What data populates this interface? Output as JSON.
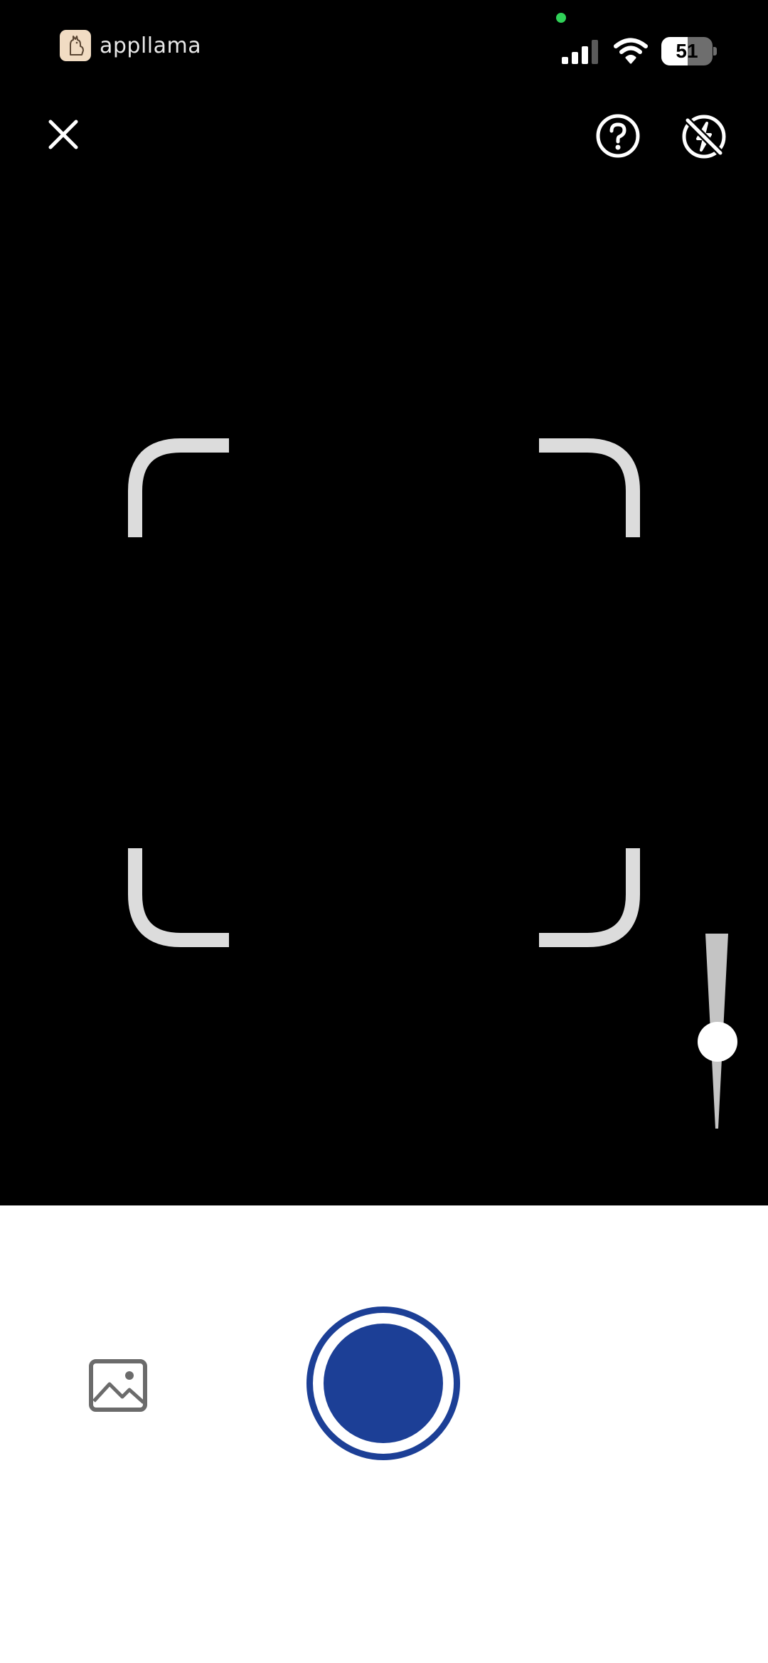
{
  "status_bar": {
    "app_name": "appllama",
    "app_logo_icon": "llama-logo-icon",
    "battery_level": "51",
    "battery_fraction": 0.51,
    "signal_icon": "cellular-signal-icon",
    "wifi_icon": "wifi-icon",
    "privacy_indicator_color": "#30d158"
  },
  "toolbar": {
    "close_icon": "close-icon",
    "help_icon": "help-circle-icon",
    "flash_icon": "flash-off-icon"
  },
  "viewfinder": {
    "frame_guide_icon": "scan-frame-corners"
  },
  "zoom": {
    "level_fraction": 0.55
  },
  "capture_panel": {
    "gallery_icon": "gallery-image-icon",
    "shutter_color": "#1c3f96"
  }
}
